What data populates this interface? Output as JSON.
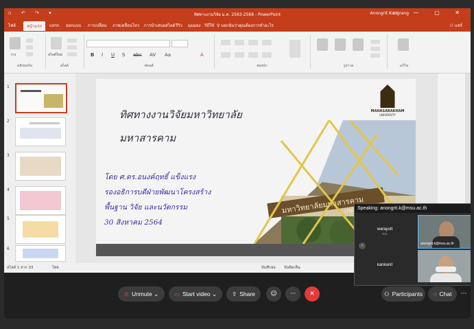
{
  "window": {
    "title": "ทิศทางงานวิจัย ม.ค. 2563-2568  -  PowerPoint",
    "user": "Anongrit Kangrang",
    "quick_access": "▫ ↶ ↷ ▾",
    "window_controls": "▭ — ▢ ✕"
  },
  "ribbon": {
    "tabs": [
      "ไฟล์",
      "หน้าแรก",
      "แทรก",
      "ออกแบบ",
      "การเปลี่ยน",
      "ภาพเคลื่อนไหว",
      "การนำเสนอสไลด์",
      "รีวิว",
      "มุมมอง",
      "วิธีใช้"
    ],
    "active_tab_index": 1,
    "tell_me": "บอกฉันว่าคุณต้องการทำอะไร",
    "share": "แชร์",
    "groups": [
      "คลิปบอร์ด",
      "สไลด์",
      "ฟอนต์",
      "ย่อหน้า",
      "รูปวาด",
      "แก้ไข"
    ],
    "paste_label": "วาง",
    "new_slide_label": "สไลด์ใหม่",
    "format_buttons": [
      "B",
      "I",
      "U",
      "S",
      "abc",
      "AV",
      "Aa",
      "A"
    ]
  },
  "thumbnails": [
    {
      "num": "1"
    },
    {
      "num": "2"
    },
    {
      "num": "3"
    },
    {
      "num": "4"
    },
    {
      "num": "5"
    },
    {
      "num": "6"
    }
  ],
  "slide": {
    "title_line1": "ทิศทางงานวิจัยมหาวิทยาลัย",
    "title_line2": "มหาสารคาม",
    "presenter": "โดย ศ.ดร.อนงค์ฤทธิ์ แข็งแรง",
    "position1": "รองอธิการบดีฝ่ายพัฒนาโครงสร้าง",
    "position2": "พื้นฐาน วิจัย และนวัตกรรม",
    "date": "30 สิงหาคม 2564",
    "logo_name": "MAHASARAKHAM",
    "logo_sub": "UNIVERSITY",
    "building_sign": "มหาวิทยาลัยมหาสารคาม",
    "building_sign_en": "UNIVERSITY"
  },
  "status": {
    "slide_count": "สไลด์ 1 จาก 33",
    "lang": "ไทย",
    "notes": "บันทึกย่อ",
    "comments": "ข้อคิดเห็น"
  },
  "meeting": {
    "unmute": "Unmute",
    "start_video": "Start video",
    "share": "Share",
    "participants": "Participants",
    "chat": "Chat",
    "speaking": "Speaking: anongrit.k@msu.ac.th",
    "participant1": "warayutt",
    "participant1_sub": "h/e",
    "participant2": "kankanit",
    "video1_label": "anongrit.k@msu.ac.th"
  },
  "colors": {
    "accent": "#c43e1c",
    "end_call": "#e23b3b",
    "slide_text": "#3a2fa0"
  }
}
